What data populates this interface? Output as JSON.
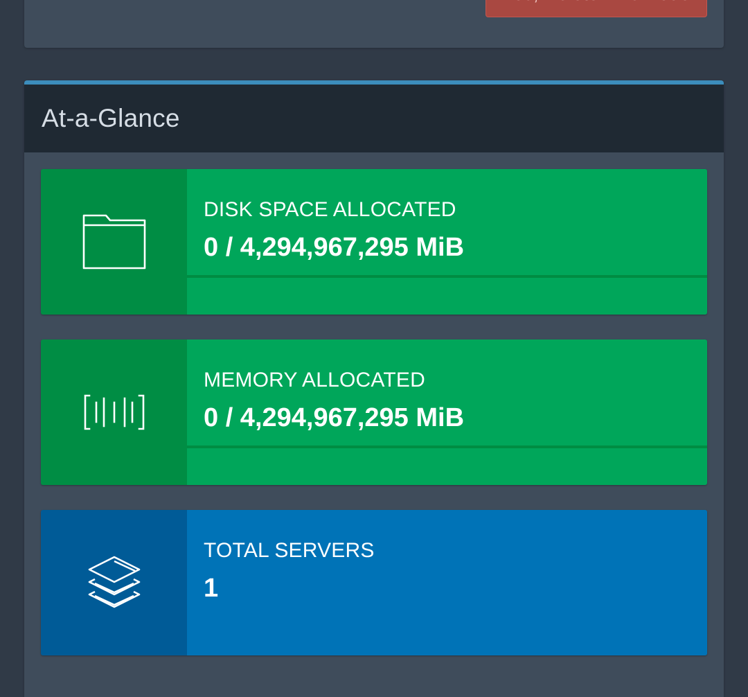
{
  "delete_panel": {
    "button_label": "Yes, Delete This Node"
  },
  "glance": {
    "title": "At-a-Glance",
    "accent_color": "#3c8dbc",
    "boxes": [
      {
        "icon": "folder-icon",
        "label": "DISK SPACE ALLOCATED",
        "value": "0 / 4,294,967,295 MiB",
        "progress": 0,
        "color": "#00a65a"
      },
      {
        "icon": "memory-icon",
        "label": "MEMORY ALLOCATED",
        "value": "0 / 4,294,967,295 MiB",
        "progress": 0,
        "color": "#00a65a"
      },
      {
        "icon": "layers-icon",
        "label": "TOTAL SERVERS",
        "value": "1",
        "color": "#0073b7"
      }
    ]
  }
}
